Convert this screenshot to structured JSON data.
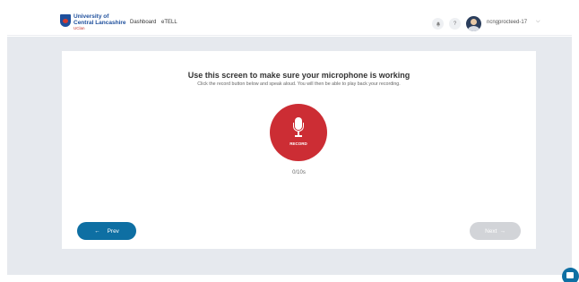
{
  "header": {
    "logo": {
      "line1": "University of",
      "line2": "Central Lancashire",
      "line3": "UClan"
    },
    "nav": [
      "Dashboard",
      "eTELL"
    ],
    "icons": {
      "notifications": "bell-icon",
      "help": "?",
      "user": "avatar-icon"
    },
    "username": "ncngprocteed-17",
    "dropdown_glyph": "⌵"
  },
  "card": {
    "title": "Use this screen to make sure your microphone is working",
    "subtitle": "Click the record button below and speak aloud. You will then be able to play back your recording.",
    "record_label": "RECORD",
    "timer": "0/10s",
    "prev": {
      "arrow": "←",
      "label": "Prev"
    },
    "next": {
      "label": "Next",
      "arrow": "→"
    }
  },
  "colors": {
    "record": "#cc2d34",
    "primary": "#0e6fa3",
    "disabled": "#d2d4d8",
    "background": "#e6e9ee"
  }
}
